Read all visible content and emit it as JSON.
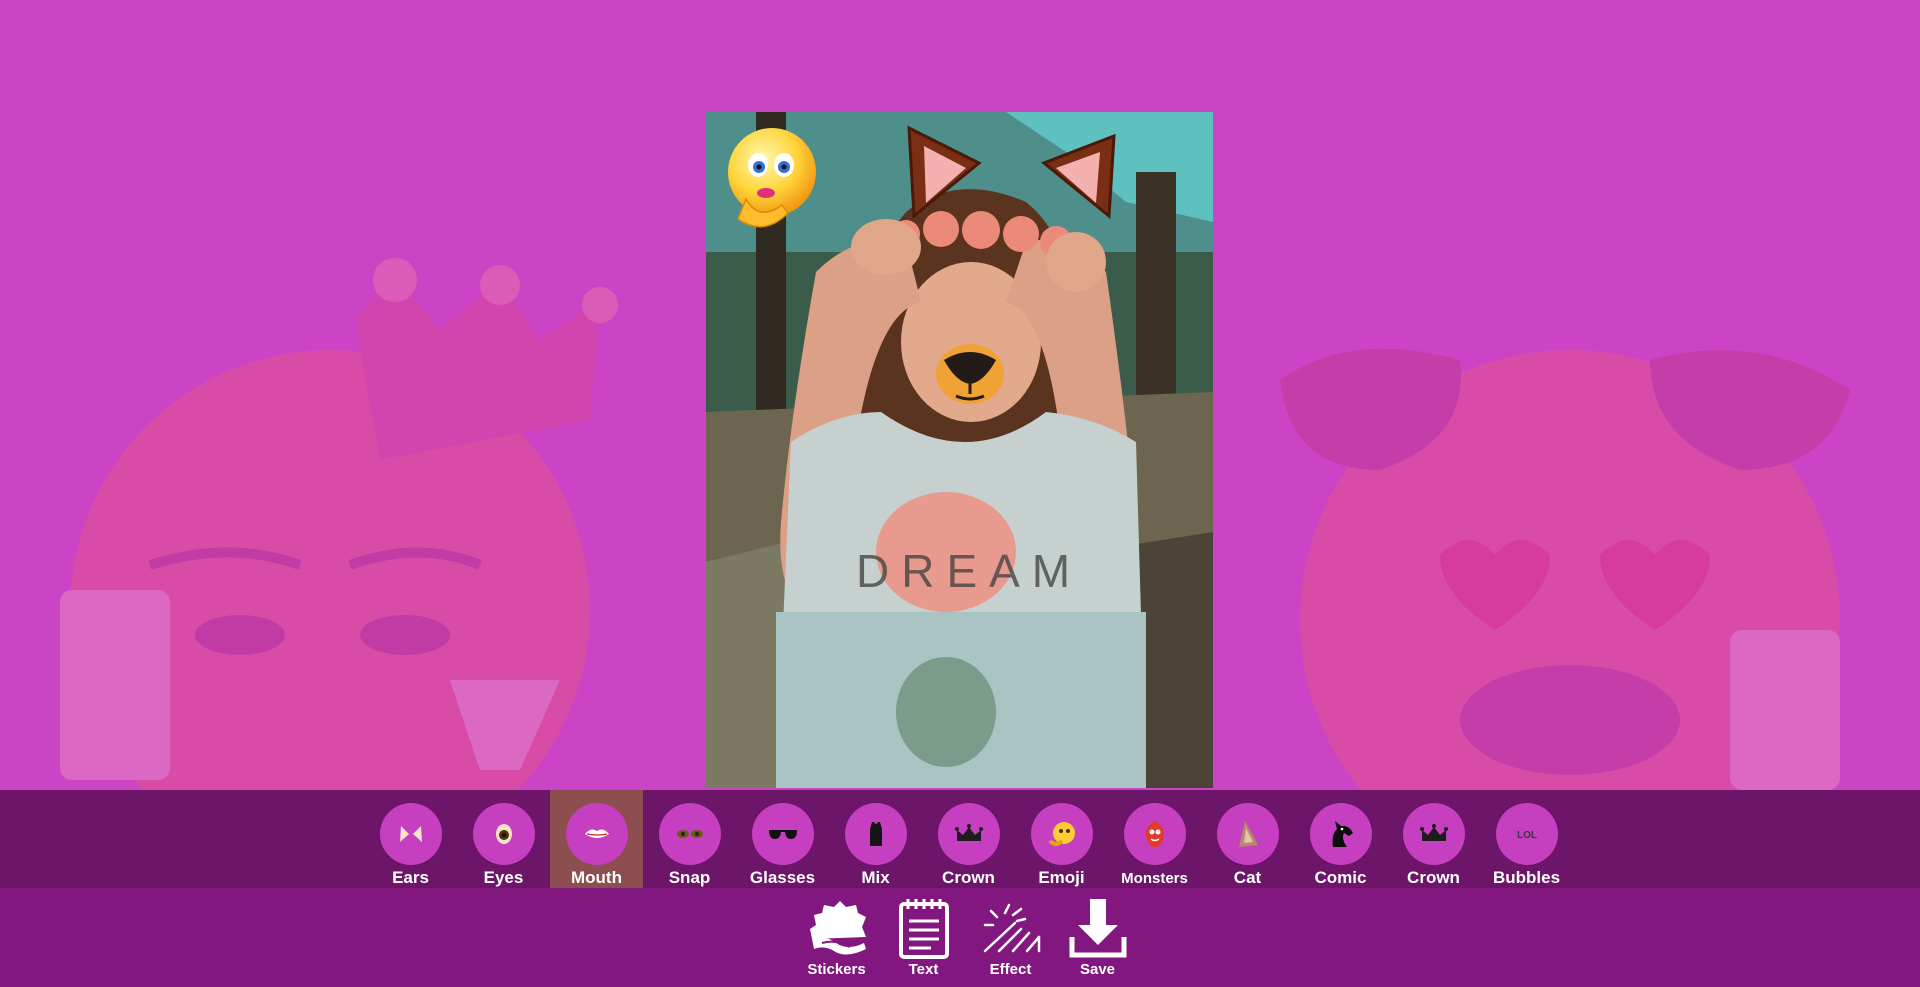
{
  "categories": [
    {
      "label": "Ears",
      "icon": "cat-ears-icon"
    },
    {
      "label": "Eyes",
      "icon": "eye-icon"
    },
    {
      "label": "Mouth",
      "icon": "lips-icon",
      "selected": true
    },
    {
      "label": "Snap",
      "icon": "snap-eyes-icon"
    },
    {
      "label": "Glasses",
      "icon": "sunglasses-icon"
    },
    {
      "label": "Mix",
      "icon": "shirt-icon"
    },
    {
      "label": "Crown",
      "icon": "crown-icon"
    },
    {
      "label": "Emoji",
      "icon": "emoji-icon"
    },
    {
      "label": "Monsters",
      "icon": "monster-icon"
    },
    {
      "label": "Cat",
      "icon": "cat-ear-icon"
    },
    {
      "label": "Comic",
      "icon": "horse-head-icon"
    },
    {
      "label": "Crown",
      "icon": "crown-icon"
    },
    {
      "label": "Bubbles",
      "icon": "lol-bubble-icon"
    }
  ],
  "bubble_text": "LOL",
  "tools": [
    {
      "label": "Stickers",
      "icon": "stickers-icon"
    },
    {
      "label": "Text",
      "icon": "notepad-icon"
    },
    {
      "label": "Effect",
      "icon": "magic-wand-icon"
    },
    {
      "label": "Save",
      "icon": "download-icon"
    }
  ],
  "photo": {
    "shirt_text": "DREAM",
    "applied_stickers": [
      "thinking-emoji-sticker",
      "cat-ears-sticker",
      "dog-nose-sticker"
    ]
  },
  "colors": {
    "background": "#cc44c6",
    "category_bar": "#6c1569",
    "tool_bar": "#831780",
    "selected_item": "#8c4e4e",
    "icon_circle": "#c63fc1"
  }
}
